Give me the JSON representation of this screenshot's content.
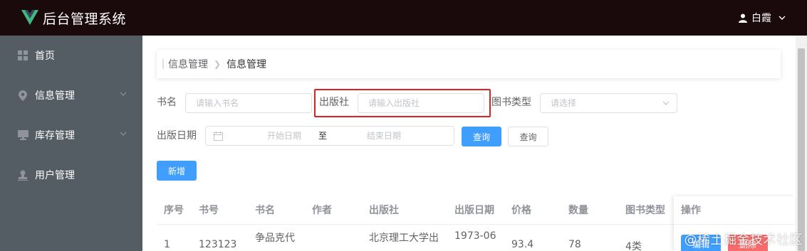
{
  "header": {
    "title": "后台管理系统",
    "user_name": "白霞"
  },
  "sidebar": {
    "items": [
      {
        "label": "首页",
        "icon": "grid-icon"
      },
      {
        "label": "信息管理",
        "icon": "location-icon",
        "has_submenu": true
      },
      {
        "label": "库存管理",
        "icon": "monitor-icon",
        "has_submenu": true
      },
      {
        "label": "用户管理",
        "icon": "user-stamp-icon"
      }
    ]
  },
  "breadcrumb": [
    "信息管理",
    "信息管理"
  ],
  "search": {
    "book_name_label": "书名",
    "book_name_placeholder": "请输入书名",
    "publisher_label": "出版社",
    "publisher_placeholder": "请输入出版社",
    "type_label": "图书类型",
    "type_placeholder": "请选择",
    "date_label": "出版日期",
    "date_start_placeholder": "开始日期",
    "date_separator": "至",
    "date_end_placeholder": "结束日期",
    "query_primary_label": "查询",
    "query_default_label": "查询"
  },
  "add_button_label": "新增",
  "table": {
    "columns": [
      "序号",
      "书号",
      "书名",
      "作者",
      "出版社",
      "出版日期",
      "价格",
      "数量",
      "图书类型",
      "操作"
    ],
    "rows": [
      {
        "index": "1",
        "isbn": "123123",
        "title": "争品克代",
        "author": "",
        "publisher": "北京理工大学出",
        "date": "1973-06",
        "price": "93.4",
        "quantity": "78",
        "type": "4类"
      }
    ],
    "edit_label": "编辑",
    "delete_label": "删除"
  },
  "watermark": "@稀土掘金技术社区",
  "colors": {
    "header_bg": "#1a0a0c",
    "sidebar_bg": "#545c64",
    "primary": "#409eff",
    "danger": "#f56c6c",
    "highlight_border": "#e02020",
    "logo_green": "#41b883"
  }
}
